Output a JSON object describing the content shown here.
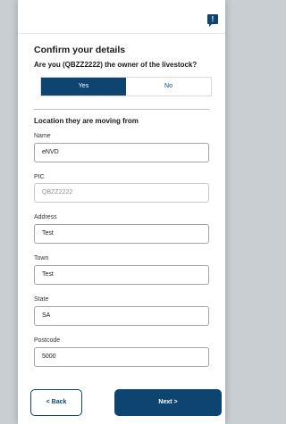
{
  "header": {
    "chat_icon": "!"
  },
  "page": {
    "title": "Confirm your details",
    "question": "Are you (QBZZ2222) the owner of the livestock?"
  },
  "owner_toggle": {
    "yes_label": "Yes",
    "no_label": "No",
    "selected": "Yes"
  },
  "section_title": "Location they are moving from",
  "fields": {
    "name": {
      "label": "Name",
      "value": "eNVD"
    },
    "pic": {
      "label": "PIC",
      "value": "QBZZ2222"
    },
    "address": {
      "label": "Address",
      "value": "Test"
    },
    "town": {
      "label": "Town",
      "value": "Test"
    },
    "state": {
      "label": "State",
      "value": "SA"
    },
    "postcode": {
      "label": "Postcode",
      "value": "5000"
    }
  },
  "footer": {
    "back_label": "< Back",
    "next_label": "Next >"
  },
  "colors": {
    "primary": "#0d4470"
  }
}
